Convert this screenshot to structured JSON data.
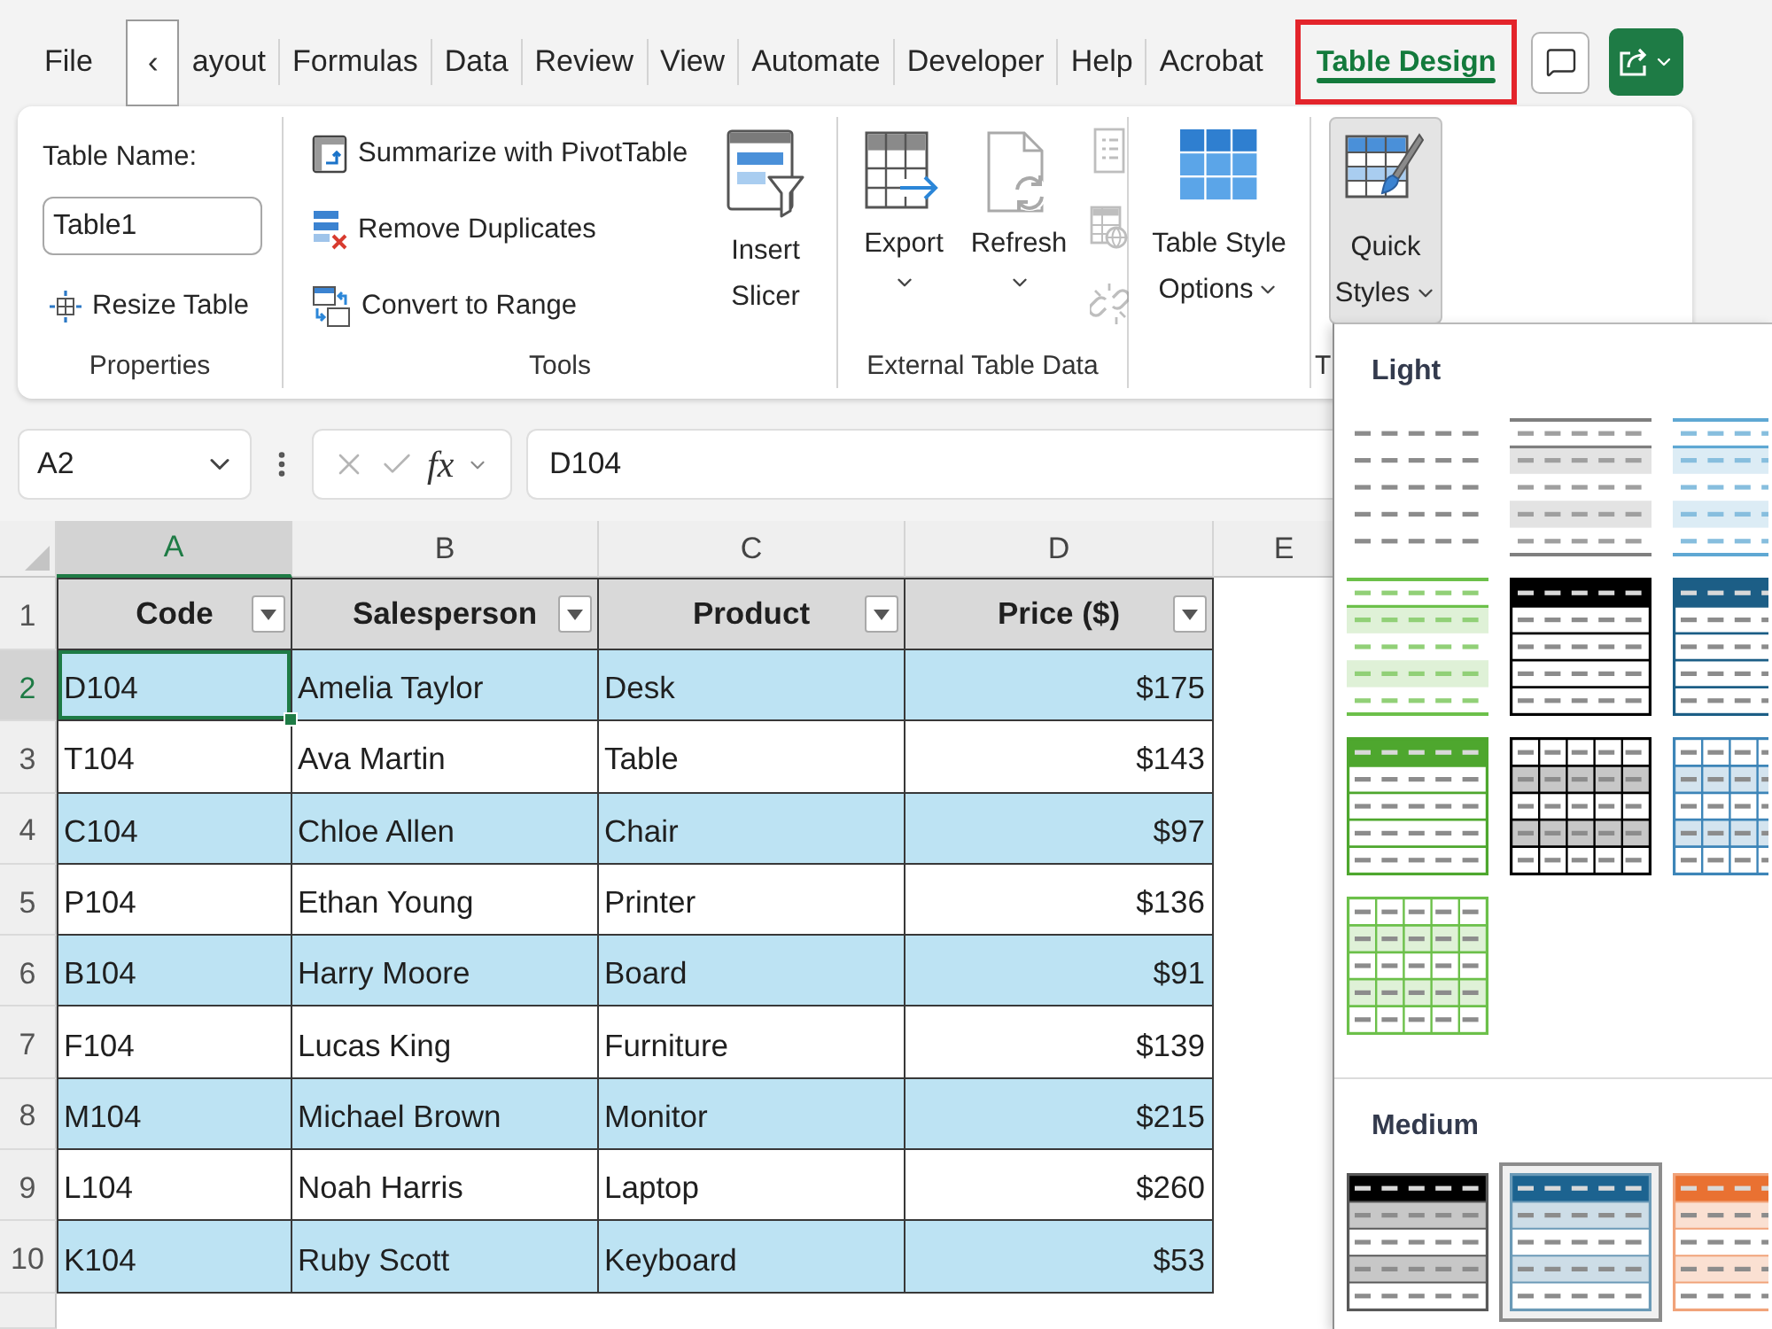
{
  "menu_bar": {
    "tabs": [
      {
        "label": "File",
        "selected": false,
        "highlighted": false
      },
      {
        "label": "ayout",
        "selected": false,
        "highlighted": false
      },
      {
        "label": "Formulas",
        "selected": false,
        "highlighted": false
      },
      {
        "label": "Data",
        "selected": false,
        "highlighted": false
      },
      {
        "label": "Review",
        "selected": false,
        "highlighted": false
      },
      {
        "label": "View",
        "selected": false,
        "highlighted": false
      },
      {
        "label": "Automate",
        "selected": false,
        "highlighted": false
      },
      {
        "label": "Developer",
        "selected": false,
        "highlighted": false
      },
      {
        "label": "Help",
        "selected": false,
        "highlighted": false
      },
      {
        "label": "Acrobat",
        "selected": false,
        "highlighted": false
      },
      {
        "label": "Table Design",
        "selected": true,
        "highlighted": true
      }
    ],
    "scroll_button": "‹"
  },
  "ribbon": {
    "properties": {
      "name_label": "Table Name:",
      "name_value": "Table1",
      "resize": "Resize Table",
      "group_label": "Properties"
    },
    "tools": {
      "commands": [
        {
          "kind": "pivot",
          "label": "Summarize with PivotTable"
        },
        {
          "kind": "duplicates",
          "label": "Remove Duplicates"
        },
        {
          "kind": "convert",
          "label": "Convert to Range"
        }
      ],
      "slicer": "Insert Slicer",
      "group_label": "Tools"
    },
    "external_data": {
      "export": "Export",
      "refresh": "Refresh",
      "small_commands": [
        {
          "kind": "properties",
          "disabled": true
        },
        {
          "kind": "browser",
          "disabled": true
        },
        {
          "kind": "unlink",
          "disabled": true
        }
      ],
      "group_label": "External Table Data"
    },
    "style_options": {
      "label": "Table Style Options"
    },
    "quick_styles": {
      "label": "Quick Styles",
      "pressed": true,
      "group_label": "T"
    }
  },
  "formula_bar": {
    "name_box": "A2",
    "function_label": "fx",
    "formula": "D104"
  },
  "sheet": {
    "columns": [
      {
        "label": "A",
        "selected": true
      },
      {
        "label": "B",
        "selected": false
      },
      {
        "label": "C",
        "selected": false
      },
      {
        "label": "D",
        "selected": false
      },
      {
        "label": "E",
        "selected": false
      }
    ],
    "row_numbers": [
      {
        "label": "1",
        "selected": false
      },
      {
        "label": "2",
        "selected": true
      },
      {
        "label": "3",
        "selected": false
      },
      {
        "label": "4",
        "selected": false
      },
      {
        "label": "5",
        "selected": false
      },
      {
        "label": "6",
        "selected": false
      },
      {
        "label": "7",
        "selected": false
      },
      {
        "label": "8",
        "selected": false
      },
      {
        "label": "9",
        "selected": false
      },
      {
        "label": "10",
        "selected": false
      }
    ],
    "table": {
      "headers": [
        {
          "label": "Code",
          "kind": "text"
        },
        {
          "label": "Salesperson",
          "kind": "text"
        },
        {
          "label": "Product",
          "kind": "text"
        },
        {
          "label": "Price ($)",
          "kind": "currency"
        }
      ],
      "rows": [
        {
          "cells": [
            {
              "text": "D104",
              "selected": true
            },
            {
              "text": "Amelia Taylor",
              "selected": false
            },
            {
              "text": "Desk",
              "selected": false
            },
            {
              "text": "$175",
              "selected": false
            }
          ]
        },
        {
          "cells": [
            {
              "text": "T104",
              "selected": false
            },
            {
              "text": "Ava Martin",
              "selected": false
            },
            {
              "text": "Table",
              "selected": false
            },
            {
              "text": "$143",
              "selected": false
            }
          ]
        },
        {
          "cells": [
            {
              "text": "C104",
              "selected": false
            },
            {
              "text": "Chloe Allen",
              "selected": false
            },
            {
              "text": "Chair",
              "selected": false
            },
            {
              "text": "$97",
              "selected": false
            }
          ]
        },
        {
          "cells": [
            {
              "text": "P104",
              "selected": false
            },
            {
              "text": "Ethan Young",
              "selected": false
            },
            {
              "text": "Printer",
              "selected": false
            },
            {
              "text": "$136",
              "selected": false
            }
          ]
        },
        {
          "cells": [
            {
              "text": "B104",
              "selected": false
            },
            {
              "text": "Harry Moore",
              "selected": false
            },
            {
              "text": "Board",
              "selected": false
            },
            {
              "text": "$91",
              "selected": false
            }
          ]
        },
        {
          "cells": [
            {
              "text": "F104",
              "selected": false
            },
            {
              "text": "Lucas King",
              "selected": false
            },
            {
              "text": "Furniture",
              "selected": false
            },
            {
              "text": "$139",
              "selected": false
            }
          ]
        },
        {
          "cells": [
            {
              "text": "M104",
              "selected": false
            },
            {
              "text": "Michael Brown",
              "selected": false
            },
            {
              "text": "Monitor",
              "selected": false
            },
            {
              "text": "$215",
              "selected": false
            }
          ]
        },
        {
          "cells": [
            {
              "text": "L104",
              "selected": false
            },
            {
              "text": "Noah Harris",
              "selected": false
            },
            {
              "text": "Laptop",
              "selected": false
            },
            {
              "text": "$260",
              "selected": false
            }
          ]
        },
        {
          "cells": [
            {
              "text": "K104",
              "selected": false
            },
            {
              "text": "Ruby Scott",
              "selected": false
            },
            {
              "text": "Keyboard",
              "selected": false
            },
            {
              "text": "$53",
              "selected": false
            }
          ]
        }
      ]
    }
  },
  "gallery": {
    "sections": [
      {
        "title": "Light",
        "styles": [
          {
            "kind": "plain",
            "selected": false
          },
          {
            "kind": "banded",
            "color": "#7f7f7f",
            "selected": false
          },
          {
            "kind": "banded",
            "color": "#5fa8d3",
            "selected": false
          },
          {
            "kind": "banded",
            "color": "#6cc04a",
            "selected": false
          },
          {
            "kind": "header",
            "color": "#000000",
            "selected": false
          },
          {
            "kind": "header",
            "color": "#1c5e86",
            "selected": false
          },
          {
            "kind": "header",
            "color": "#4ea72e",
            "selected": false
          },
          {
            "kind": "grid",
            "color": "#000000",
            "selected": false
          },
          {
            "kind": "grid",
            "color": "#3d85b8",
            "selected": false
          },
          {
            "kind": "grid",
            "color": "#6cc04a",
            "selected": false
          }
        ]
      },
      {
        "title": "Medium",
        "styles": [
          {
            "kind": "medium",
            "color": "#000000",
            "selected": false
          },
          {
            "kind": "medium",
            "color": "#1c6390",
            "selected": true
          },
          {
            "kind": "medium",
            "color": "#e97132",
            "selected": false
          }
        ]
      }
    ]
  }
}
